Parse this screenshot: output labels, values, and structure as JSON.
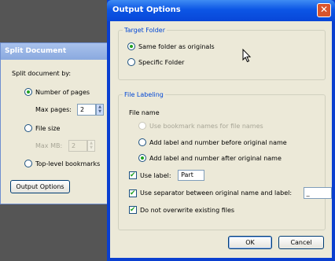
{
  "split_window": {
    "title": "Split Document",
    "prompt": "Split document by:",
    "options": [
      "Number of pages",
      "File size",
      "Top-level bookmarks"
    ],
    "max_pages_label": "Max pages:",
    "max_pages_value": "2",
    "max_mb_label": "Max MB:",
    "max_mb_value": "2",
    "output_button": "Output Options"
  },
  "dialog": {
    "title": "Output Options",
    "close_glyph": "✕",
    "target_folder": {
      "legend": "Target Folder",
      "options": [
        "Same folder as originals",
        "Specific Folder"
      ]
    },
    "file_labeling": {
      "legend": "File Labeling",
      "file_name_label": "File name",
      "options": [
        "Use bookmark names for file names",
        "Add label and number before original name",
        "Add label and number after original name"
      ],
      "use_label": "Use label:",
      "label_value": "Part",
      "use_separator": "Use separator between original name and label:",
      "separator_value": "_",
      "no_overwrite": "Do not overwrite existing files"
    },
    "ok": "OK",
    "cancel": "Cancel"
  },
  "colors": {
    "title_bar": "#0c56e5",
    "dialog_bg": "#ece9d8",
    "group_label": "#0046d5",
    "desktop": "#555555"
  }
}
